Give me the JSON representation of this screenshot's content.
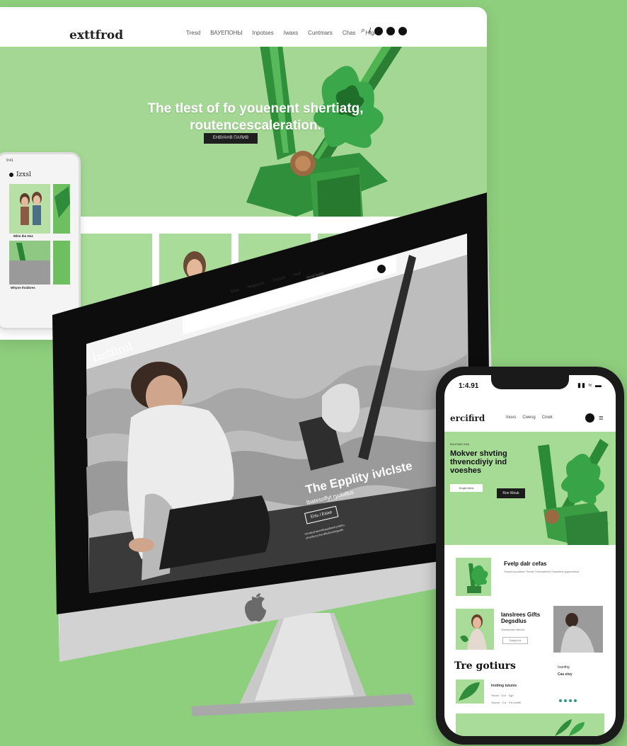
{
  "back_site": {
    "logo": "exttfrod",
    "nav": [
      "Tresd",
      "ВАУЕПОНЫ",
      "Inpotses",
      "Iwaxs",
      "Cuntmars",
      "Chas",
      "Hlgh"
    ],
    "search_icon": "search-icon",
    "divider": "/",
    "hero_title": "The tlest of fo youenent shertiatg, routencescaleration.",
    "hero_button": "ЕНВУАНВ ПАЯИВ"
  },
  "phone_left": {
    "status_time": "9:41",
    "logo": "Izxsl",
    "caption_1": "Mlrie Ibs Hoz",
    "caption_2": "Whyne Ihcbbres"
  },
  "imac": {
    "logo": "Izstfirol",
    "nav": [
      "Dew",
      "Helpszes",
      "Tresutt",
      "Ired"
    ],
    "search_placeholder": "Istnaf laalat",
    "hero_title": "The Epplity ivlclste",
    "hero_subtitle": "Ibatesoflyt ryuloltus",
    "hero_button": "Ertu / Exixe",
    "hero_body": "Inrcaloyhaenntbaqulbantryrttdhu, uhortfsvrycherdfisoliveshtgwlfe"
  },
  "phone_right": {
    "status_time": "1:4.91",
    "status_icons": "▮▮ ≈ ▬",
    "logo": "ercifird",
    "nav": [
      "Inuvs",
      "Cwesg",
      "Cnwk"
    ],
    "hero_eyebrow": "BUHOWE IHIN",
    "hero_title": "Mokver shvting thvencdiyiy ind voeshes",
    "hero_button_outline": "Dhqtrt Wrtlx",
    "hero_button_dark": "Ron Wouk",
    "card_1_title": "Fvelp dalr cefas",
    "card_1_text": "Thaiqns bynotlswer Thevtre Thesrewtheldl Yloweltnhs ryngtevsfnsue.",
    "card_2_title": "Ianslrees Gifts Degsdlus",
    "card_2_text": "Tetnseluhaer Wehcre",
    "card_2_button": "Eytgeg unt",
    "section_heading": "Tre gotiurs",
    "list_label": "Ioanthg",
    "list_title": "Cas etvy",
    "list_item_title": "Inotlmg tutunis",
    "list_item_meta": "Sitodo · Dxt · Sgb",
    "list_item_meta2": "Sswob · Ctz · Ed-nedlttl"
  }
}
